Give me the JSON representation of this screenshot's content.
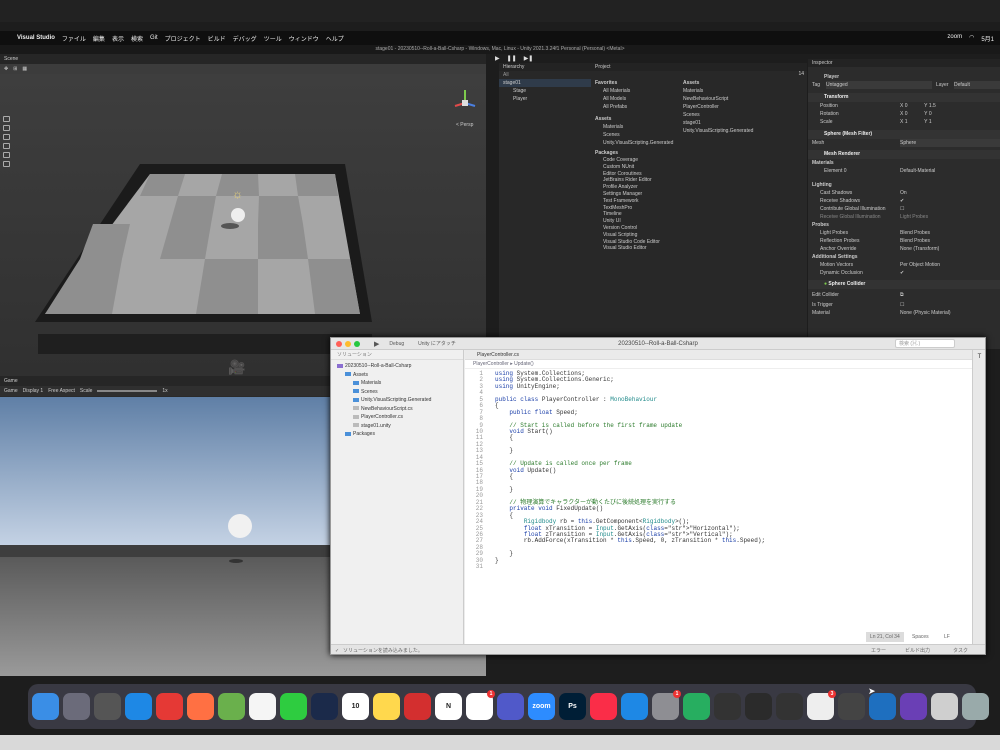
{
  "menubar": {
    "app_name": "Visual Studio",
    "items": [
      "ファイル",
      "編集",
      "表示",
      "検索",
      "Git",
      "プロジェクト",
      "ビルド",
      "デバッグ",
      "ツール",
      "ウィンドウ",
      "ヘルプ"
    ],
    "right_items": [
      "zoom",
      "5月1"
    ]
  },
  "unity": {
    "window_title": "stage01 - 20230510--Roll-a-Ball-Csharp - Windows, Mac, Linux - Unity 2021.3.24f1 Personal (Personal) <Metal>",
    "scene_tab": "Scene",
    "persp_label": "< Persp",
    "game_tab": "Game",
    "game_toolbar": {
      "display": "Game",
      "display_no": "Display 1",
      "aspect": "Free Aspect",
      "scale_label": "Scale",
      "scale_value": "1x"
    },
    "hierarchy": {
      "title": "Hierarchy",
      "search": "All",
      "items": [
        "stage01",
        "Stage",
        "Player"
      ]
    },
    "project": {
      "title": "Project",
      "favorites": {
        "label": "Favorites",
        "items": [
          "All Materials",
          "All Models",
          "All Prefabs"
        ]
      },
      "assets": {
        "label": "Assets",
        "items": [
          "Materials",
          "Scenes",
          "Unity.VisualScripting.Generated"
        ]
      },
      "packages": {
        "label": "Packages",
        "items": [
          "Code Coverage",
          "Custom NUnit",
          "Editor Coroutines",
          "JetBrains Rider Editor",
          "Profile Analyzer",
          "Settings Manager",
          "Test Framework",
          "TextMeshPro",
          "Timeline",
          "Unity UI",
          "Version Control",
          "Visual Scripting",
          "Visual Studio Code Editor",
          "Visual Studio Editor"
        ]
      },
      "right_header": "Assets",
      "right_items": [
        "Materials",
        "NewBehaviourScript",
        "PlayerController",
        "Scenes",
        "stage01",
        "Unity.VisualScripting.Generated"
      ],
      "counter": "14"
    },
    "inspector": {
      "title": "Inspector",
      "layers": "Layers",
      "object_name": "Player",
      "tag_label": "Tag",
      "tag_value": "Untagged",
      "layer_label": "Layer",
      "layer_value": "Default",
      "transform": {
        "label": "Transform",
        "position": {
          "label": "Position",
          "x": "0",
          "y": "1.5"
        },
        "rotation": {
          "label": "Rotation",
          "x": "0",
          "y": "0"
        },
        "scale": {
          "label": "Scale",
          "x": "1",
          "y": "1"
        }
      },
      "mesh_filter": {
        "label": "Sphere (Mesh Filter)",
        "mesh_label": "Mesh",
        "mesh_value": "Sphere"
      },
      "mesh_renderer": {
        "label": "Mesh Renderer",
        "materials": "Materials",
        "element0": "Element 0",
        "element0_value": "Default-Material",
        "lighting": "Lighting",
        "cast_shadows": "Cast Shadows",
        "cast_shadows_value": "On",
        "receive_shadows": "Receive Shadows",
        "contribute_gi": "Contribute Global Illumination",
        "receive_gi": "Receive Global Illumination",
        "receive_gi_value": "Light Probes",
        "probes": "Probes",
        "light_probes": "Light Probes",
        "light_probes_value": "Blend Probes",
        "reflection_probes": "Reflection Probes",
        "reflection_probes_value": "Blend Probes",
        "anchor_override": "Anchor Override",
        "anchor_override_value": "None (Transform)",
        "additional": "Additional Settings",
        "motion_vectors": "Motion Vectors",
        "motion_vectors_value": "Per Object Motion",
        "dynamic_occlusion": "Dynamic Occlusion"
      },
      "sphere_collider": {
        "label": "Sphere Collider",
        "edit": "Edit Collider",
        "is_trigger": "Is Trigger",
        "material": "Material",
        "material_value": "None (Physic Material)"
      }
    }
  },
  "vs": {
    "window_title": "20230510--Roll-a-Ball-Csharp",
    "config": "Debug",
    "target": "Unity にアタッチ",
    "solution_label": "ソリューション",
    "tree": [
      "20230510--Roll-a-Ball-Csharp",
      "Assets",
      "Materials",
      "Scenes",
      "Unity.VisualScripting.Generated",
      "NewBehaviourScript.cs",
      "PlayerController.cs",
      "stage01.unity",
      "Packages"
    ],
    "tab": "PlayerController.cs",
    "breadcrumb_class": "PlayerController",
    "breadcrumb_method": "Update()",
    "search_placeholder": "検索 (⌘.)",
    "code_lines": [
      "using System.Collections;",
      "using System.Collections.Generic;",
      "using UnityEngine;",
      "",
      "public class PlayerController : MonoBehaviour",
      "{",
      "    public float Speed;",
      "",
      "    // Start is called before the first frame update",
      "    void Start()",
      "    {",
      "",
      "    }",
      "",
      "    // Update is called once per frame",
      "    void Update()",
      "    {",
      "",
      "    }",
      "",
      "    // 物理演算でキャラクターが動くたびに後続処理を実行する",
      "    private void FixedUpdate()",
      "    {",
      "        Rigidbody rb = this.GetComponent<Rigidbody>();",
      "        float xTransition = Input.GetAxis(\"Horizontal\");",
      "        float zTransition = Input.GetAxis(\"Vertical\");",
      "        rb.AddForce(xTransition * this.Speed, 0, zTransition * this.Speed);",
      "",
      "    }",
      "}",
      ""
    ],
    "status_left": "ソリューションを読み込みました。",
    "cursor": "Ln 21, Col 34",
    "indent": "Spaces",
    "eol": "LF",
    "errors": "エラー",
    "build_output": "ビルド出力",
    "tasks": "タスク"
  },
  "dock": {
    "apps": [
      {
        "name": "finder-icon",
        "color": "#3a8ee6",
        "label": ""
      },
      {
        "name": "launchpad-icon",
        "color": "#6b6b7a",
        "label": ""
      },
      {
        "name": "calculator-icon",
        "color": "#555",
        "label": ""
      },
      {
        "name": "safari-icon",
        "color": "#1e88e5",
        "label": ""
      },
      {
        "name": "chrome-icon",
        "color": "#e53935",
        "label": ""
      },
      {
        "name": "firefox-icon",
        "color": "#ff7043",
        "label": ""
      },
      {
        "name": "notes-draw-icon",
        "color": "#6ab04c",
        "label": ""
      },
      {
        "name": "photos-icon",
        "color": "#f5f5f5",
        "label": ""
      },
      {
        "name": "facetime-icon",
        "color": "#2ecc40",
        "label": ""
      },
      {
        "name": "vscode-like-icon",
        "color": "#1b2a4a",
        "label": ""
      },
      {
        "name": "calendar-icon",
        "color": "#ffffff",
        "label": "10"
      },
      {
        "name": "notes-icon",
        "color": "#ffd84d",
        "label": ""
      },
      {
        "name": "acrobat-icon",
        "color": "#d32f2f",
        "label": ""
      },
      {
        "name": "notion-icon",
        "color": "#ffffff",
        "label": "N"
      },
      {
        "name": "slack-icon",
        "color": "#ffffff",
        "label": "",
        "badge": "1"
      },
      {
        "name": "teams-icon",
        "color": "#5059c9",
        "label": ""
      },
      {
        "name": "zoom-icon",
        "color": "#2d8cff",
        "label": "zoom"
      },
      {
        "name": "photoshop-icon",
        "color": "#001e36",
        "label": "Ps"
      },
      {
        "name": "music-icon",
        "color": "#fa2d48",
        "label": ""
      },
      {
        "name": "appstore-icon",
        "color": "#1e88e5",
        "label": ""
      },
      {
        "name": "settings-icon",
        "color": "#8e8e93",
        "label": "",
        "badge": "1"
      },
      {
        "name": "numbers-icon",
        "color": "#27ae60",
        "label": ""
      },
      {
        "name": "movie-icon",
        "color": "#333",
        "label": ""
      },
      {
        "name": "activity-monitor-icon",
        "color": "#2b2b2b",
        "label": ""
      },
      {
        "name": "unity-hub-icon",
        "color": "#333",
        "label": ""
      },
      {
        "name": "microsoft-office-icon",
        "color": "#eee",
        "label": "",
        "badge": "3"
      },
      {
        "name": "unity-icon",
        "color": "#444",
        "label": ""
      },
      {
        "name": "visual-studio-code-icon",
        "color": "#1e6fbf",
        "label": ""
      },
      {
        "name": "visual-studio-icon",
        "color": "#6a3fb5",
        "label": ""
      },
      {
        "name": "document-icon",
        "color": "#cfcfcf",
        "label": ""
      },
      {
        "name": "trash-icon",
        "color": "#9aa",
        "label": ""
      }
    ]
  }
}
